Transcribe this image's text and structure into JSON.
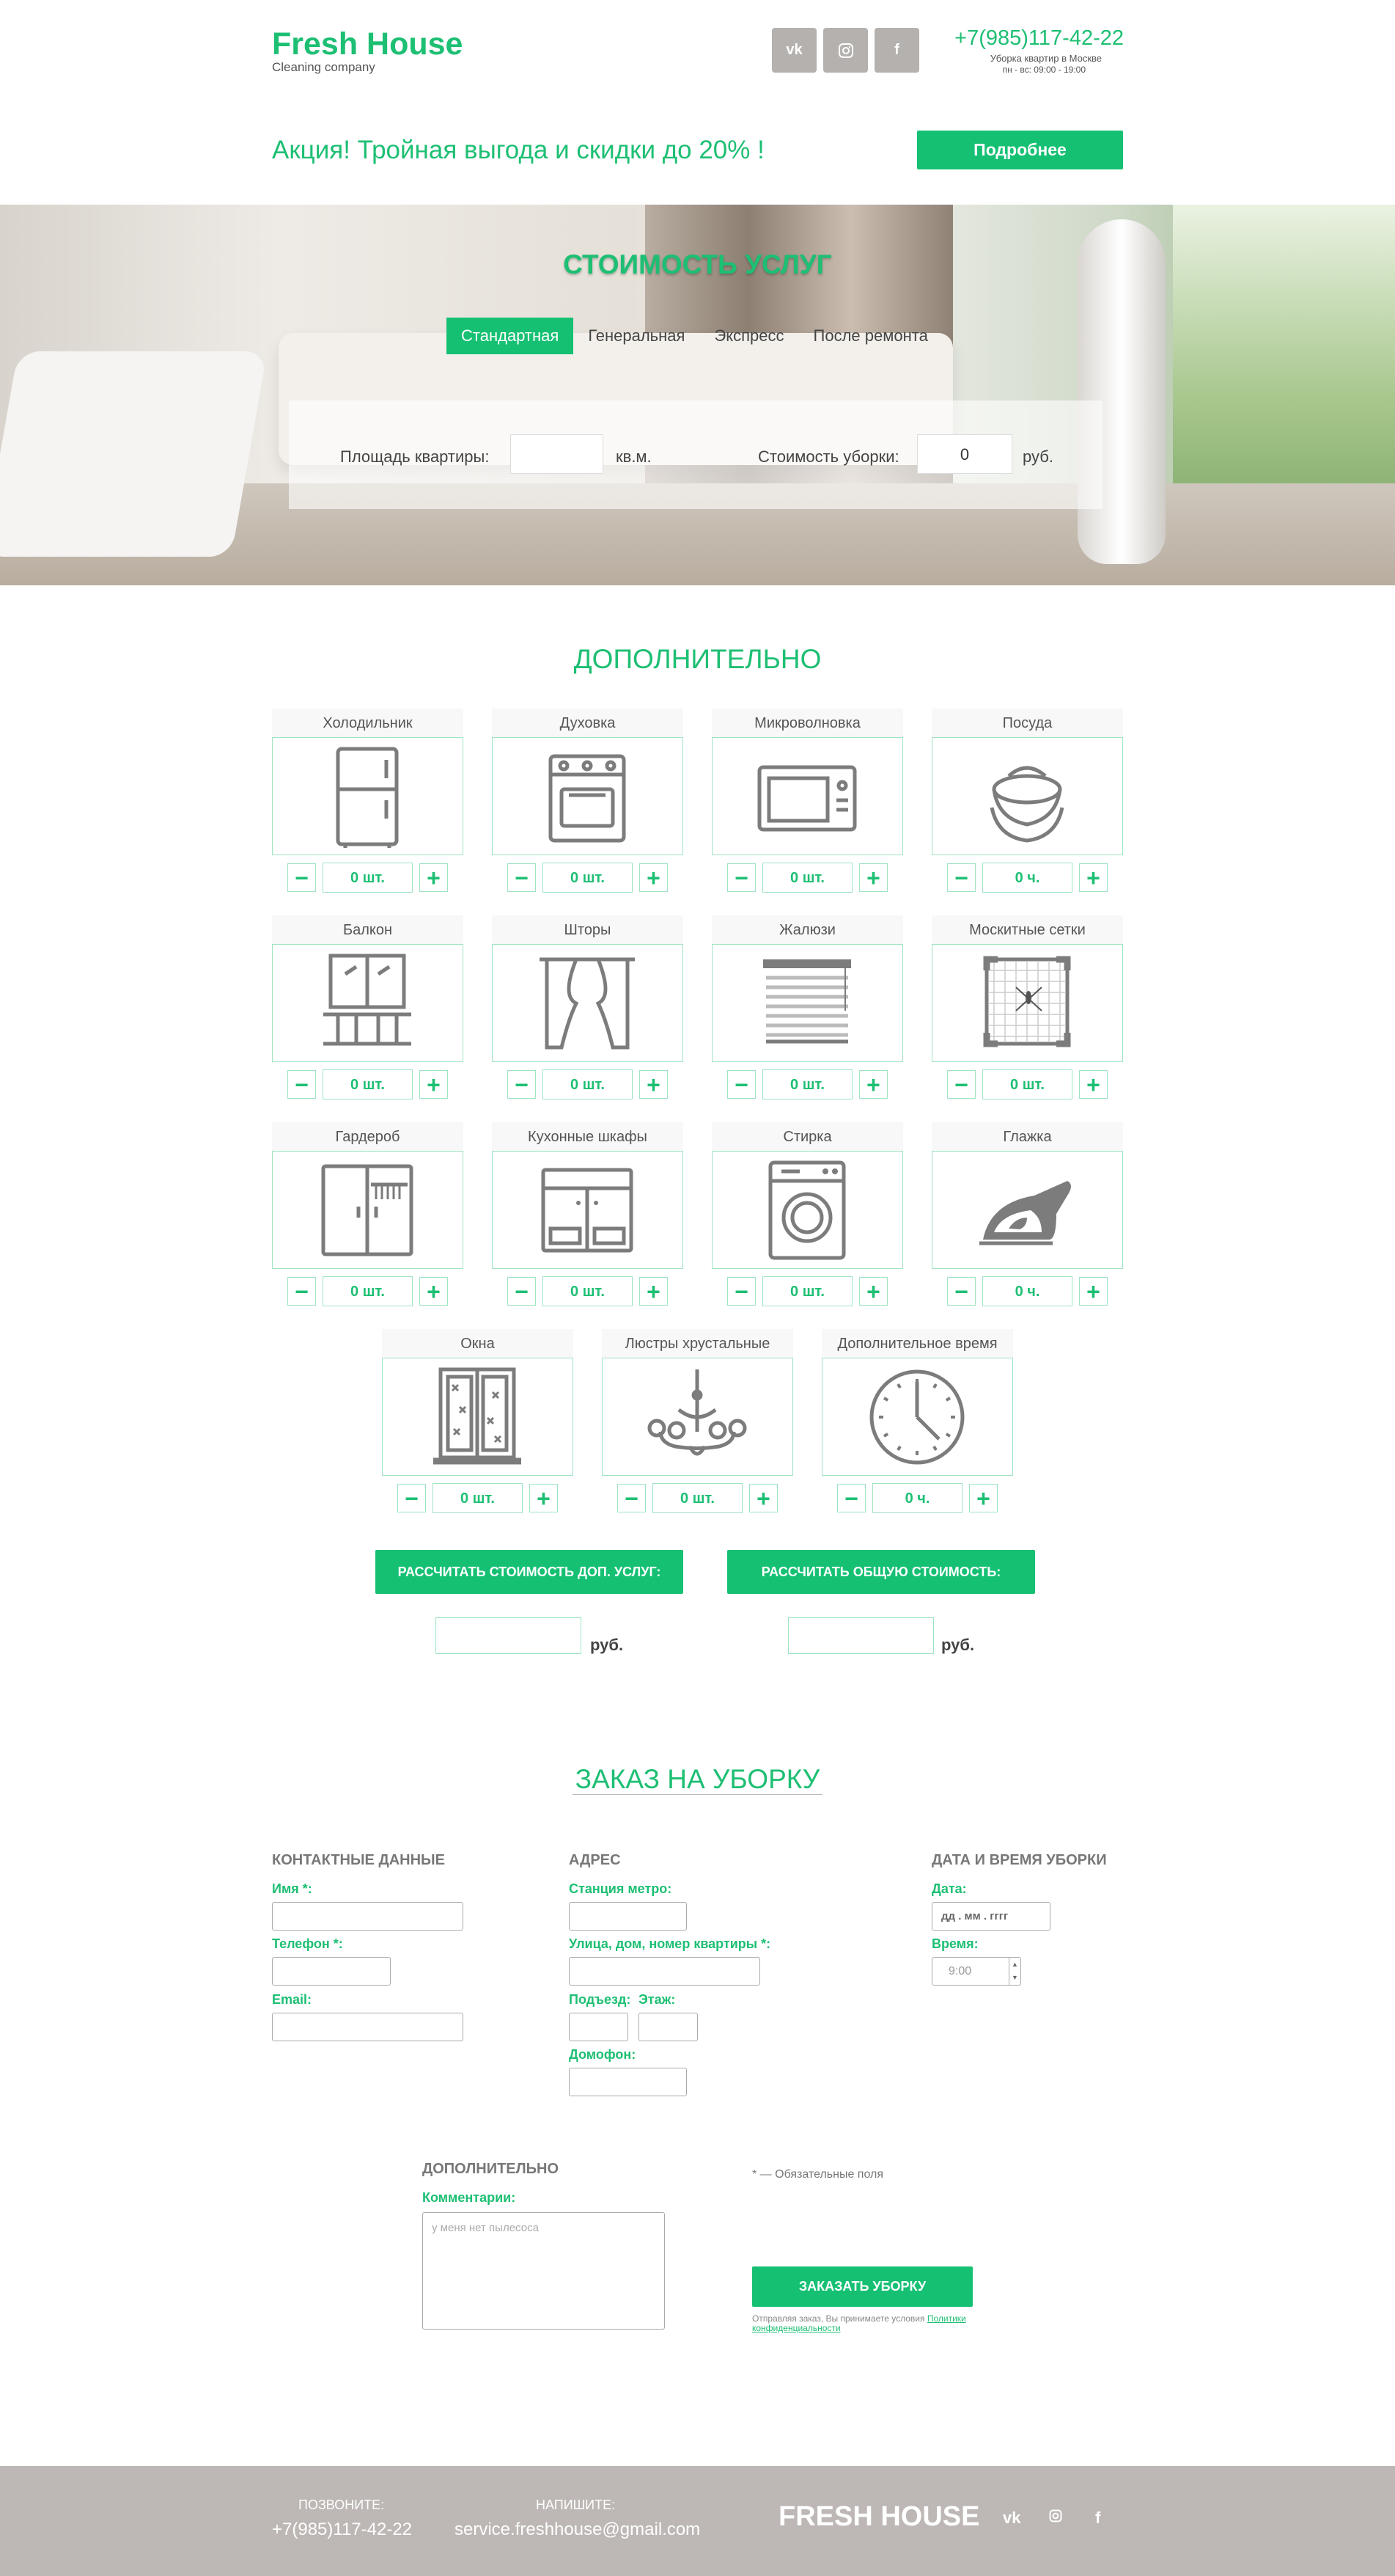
{
  "header": {
    "logo": "Fresh House",
    "logo_sub": "Cleaning company",
    "social": [
      "vk",
      "ig",
      "f"
    ],
    "phone": "+7(985)117-42-22",
    "hours_line1": "Уборка квартир в Москве",
    "hours_line2": "пн - вс: 09:00 - 19:00"
  },
  "promo": {
    "text": "Акция! Тройная выгода и скидки до 20% !",
    "button": "Подробнее"
  },
  "pricing": {
    "title": "СТОИМОСТЬ УСЛУГ",
    "tabs": [
      "Стандартная",
      "Генеральная",
      "Экспресс",
      "После ремонта"
    ],
    "active_tab": "Стандартная",
    "area_label": "Площадь квартиры:",
    "area_value": "",
    "area_unit": "кв.м.",
    "cost_label": "Стоимость уборки:",
    "cost_value": "0",
    "cost_unit": "руб."
  },
  "extras": {
    "title": "ДОПОЛНИТЕЛЬНО",
    "items": [
      {
        "title": "Холодильник",
        "qty": "0 шт.",
        "icon": "fridge-icon"
      },
      {
        "title": "Духовка",
        "qty": "0 шт.",
        "icon": "oven-icon"
      },
      {
        "title": "Микроволновка",
        "qty": "0 шт.",
        "icon": "microwave-icon"
      },
      {
        "title": "Посуда",
        "qty": "0 ч.",
        "icon": "dishes-icon"
      },
      {
        "title": "Балкон",
        "qty": "0 шт.",
        "icon": "balcony-icon"
      },
      {
        "title": "Шторы",
        "qty": "0 шт.",
        "icon": "curtains-icon"
      },
      {
        "title": "Жалюзи",
        "qty": "0 шт.",
        "icon": "blinds-icon"
      },
      {
        "title": "Москитные сетки",
        "qty": "0 шт.",
        "icon": "mosquito-net-icon"
      },
      {
        "title": "Гардероб",
        "qty": "0 шт.",
        "icon": "wardrobe-icon"
      },
      {
        "title": "Кухонные шкафы",
        "qty": "0 шт.",
        "icon": "kitchen-cabinet-icon"
      },
      {
        "title": "Стирка",
        "qty": "0 шт.",
        "icon": "washing-machine-icon"
      },
      {
        "title": "Глажка",
        "qty": "0 ч.",
        "icon": "iron-icon"
      },
      {
        "title": "Окна",
        "qty": "0 шт.",
        "icon": "window-icon"
      },
      {
        "title": "Люстры хрустальные",
        "qty": "0 шт.",
        "icon": "chandelier-icon"
      },
      {
        "title": "Дополнительное время",
        "qty": "0 ч.",
        "icon": "clock-icon"
      }
    ],
    "calc_extra_btn": "РАССЧИТАТЬ СТОИМОСТЬ ДОП. УСЛУГ:",
    "calc_total_btn": "РАССЧИТАТЬ ОБЩУЮ СТОИМОСТЬ:",
    "unit": "руб."
  },
  "order": {
    "title": "ЗАКАЗ НА УБОРКУ",
    "contacts_title": "КОНТАКТНЫЕ ДАННЫЕ",
    "name_label": "Имя *:",
    "phone_label": "Телефон *:",
    "email_label": "Email:",
    "address_title": "АДРЕС",
    "metro_label": "Станция метро:",
    "street_label": "Улица, дом, номер квартиры *:",
    "entrance_label": "Подъезд:",
    "floor_label": "Этаж:",
    "intercom_label": "Домофон:",
    "datetime_title": "ДАТА И ВРЕМЯ УБОРКИ",
    "date_label": "Дата:",
    "date_placeholder": "дд . мм . гггг",
    "time_label": "Время:",
    "time_value": "9:00",
    "extra_title": "ДОПОЛНИТЕЛЬНО",
    "comment_label": "Комментарии:",
    "comment_placeholder": "у меня нет пылесоса",
    "required_note": "* — Обязательные поля",
    "submit": "ЗАКАЗАТЬ УБОРКУ",
    "consent_text": "Отправляя заказ, Вы принимаете условия ",
    "consent_link": "Политики конфиденциальности"
  },
  "footer": {
    "call_caption": "ПОЗВОНИТЕ:",
    "call_value": "+7(985)117-42-22",
    "write_caption": "НАПИШИТЕ:",
    "write_value": "service.freshhouse@gmail.com",
    "logo": "FRESH HOUSE",
    "social": [
      "vk",
      "ig",
      "f"
    ]
  },
  "colors": {
    "accent": "#15c073",
    "footer": "#bdb8b5",
    "border": "#9ee4c2"
  }
}
